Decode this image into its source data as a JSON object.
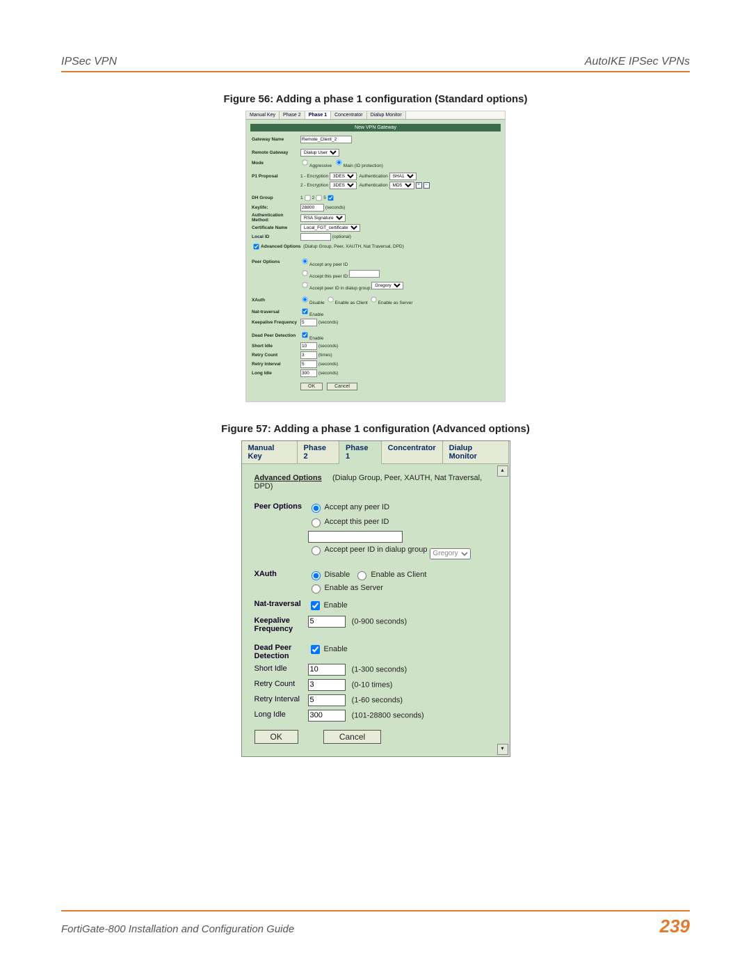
{
  "header": {
    "left": "IPSec VPN",
    "right": "AutoIKE IPSec VPNs"
  },
  "figure56": {
    "caption": "Figure 56: Adding a phase 1 configuration (Standard options)",
    "tabs": [
      "Manual Key",
      "Phase 2",
      "Phase 1",
      "Concentrator",
      "Dialup Monitor"
    ],
    "panel_title": "New VPN Gateway",
    "gateway_name_label": "Gateway Name",
    "gateway_name_value": "Remote_Client_2",
    "remote_gateway_label": "Remote Gateway",
    "remote_gateway_value": "Dialup User",
    "mode_label": "Mode",
    "mode_aggressive": "Aggressive",
    "mode_main": "Main (ID protection)",
    "p1_label": "P1 Proposal",
    "enc1_label": "1 - Encryption",
    "enc1_value": "3DES",
    "auth1_label": "Authentication",
    "auth1_value": "SHA1",
    "enc2_label": "2 - Encryption",
    "enc2_value": "3DES",
    "auth2_label": "Authentication",
    "auth2_value": "MD5",
    "dh_label": "DH Group",
    "dh_opts": [
      "1",
      "2",
      "5"
    ],
    "keylife_label": "Keylife:",
    "keylife_value": "28800",
    "keylife_unit": "(seconds)",
    "auth_method_label": "Authentication Method:",
    "auth_method_value": "RSA Signature",
    "cert_name_label": "Certificate Name",
    "cert_name_value": "Local_FGT_certificate",
    "local_id_label": "Local ID",
    "local_id_hint": "(optional)",
    "adv_label": "Advanced Options",
    "adv_hint": "(Dialup Group, Peer, XAUTH, Nat Traversal, DPD)",
    "peer_opts_label": "Peer Options",
    "peer_any": "Accept any peer ID",
    "peer_this": "Accept this peer ID:",
    "peer_group": "Accept peer ID in dialup group:",
    "peer_group_value": "Gregory",
    "xauth_label": "XAuth",
    "xauth_disable": "Disable",
    "xauth_client": "Enable as Client",
    "xauth_server": "Enable as Server",
    "nat_label": "Nat-traversal",
    "enable": "Enable",
    "keepalive_label": "Keepalive Frequency",
    "keepalive_value": "5",
    "keepalive_unit": "(seconds)",
    "dpd_label": "Dead Peer Detection",
    "short_idle_label": "Short Idle",
    "short_idle_value": "10",
    "short_idle_unit": "(seconds)",
    "retry_count_label": "Retry Count",
    "retry_count_value": "3",
    "retry_count_unit": "(times)",
    "retry_interval_label": "Retry Interval",
    "retry_interval_value": "5",
    "retry_interval_unit": "(seconds)",
    "long_idle_label": "Long Idle",
    "long_idle_value": "300",
    "long_idle_unit": "(seconds)",
    "ok": "OK",
    "cancel": "Cancel"
  },
  "figure57": {
    "caption": "Figure 57: Adding a phase 1 configuration (Advanced options)",
    "tabs": [
      "Manual Key",
      "Phase 2",
      "Phase 1",
      "Concentrator",
      "Dialup Monitor"
    ],
    "adv_label": "Advanced Options",
    "adv_hint": "(Dialup Group, Peer, XAUTH, Nat Traversal, DPD)",
    "peer_label": "Peer Options",
    "peer_any": "Accept any peer ID",
    "peer_this": "Accept this peer ID",
    "peer_group": "Accept peer ID in dialup group",
    "peer_group_value": "Gregory",
    "xauth_label": "XAuth",
    "xauth_disable": "Disable",
    "xauth_client": "Enable as Client",
    "xauth_server": "Enable as Server",
    "nat_label": "Nat-traversal",
    "enable": "Enable",
    "keepalive_label": "Keepalive Frequency",
    "keepalive_value": "5",
    "keepalive_hint": "(0-900 seconds)",
    "dpd_label": "Dead Peer Detection",
    "short_idle_label": "Short Idle",
    "short_idle_value": "10",
    "short_idle_hint": "(1-300 seconds)",
    "retry_count_label": "Retry Count",
    "retry_count_value": "3",
    "retry_count_hint": "(0-10 times)",
    "retry_interval_label": "Retry Interval",
    "retry_interval_value": "5",
    "retry_interval_hint": "(1-60 seconds)",
    "long_idle_label": "Long Idle",
    "long_idle_value": "300",
    "long_idle_hint": "(101-28800 seconds)",
    "ok": "OK",
    "cancel": "Cancel"
  },
  "footer": {
    "title": "FortiGate-800 Installation and Configuration Guide",
    "page": "239"
  }
}
